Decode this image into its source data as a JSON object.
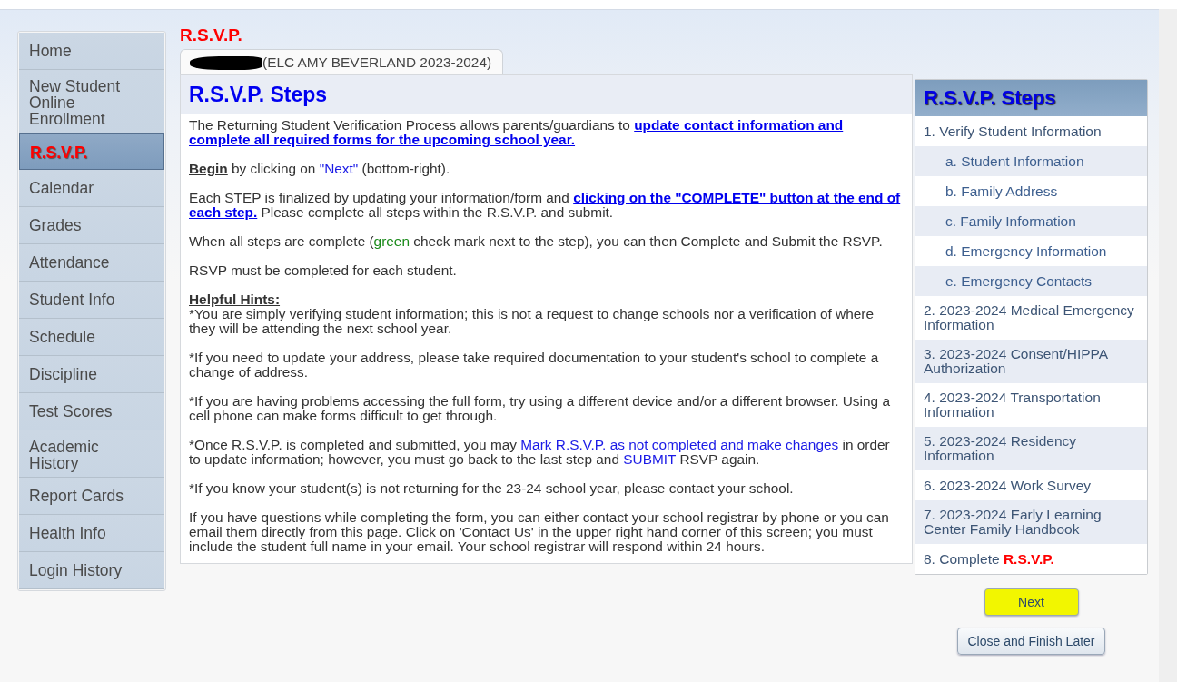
{
  "page_title": "R.S.V.P.",
  "sidebar": {
    "items": [
      {
        "label": "Home",
        "selected": false
      },
      {
        "label": "New Student Online Enrollment",
        "selected": false
      },
      {
        "label": "R.S.V.P.",
        "selected": true
      },
      {
        "label": "Calendar",
        "selected": false
      },
      {
        "label": "Grades",
        "selected": false
      },
      {
        "label": "Attendance",
        "selected": false
      },
      {
        "label": "Student Info",
        "selected": false
      },
      {
        "label": "Schedule",
        "selected": false
      },
      {
        "label": "Discipline",
        "selected": false
      },
      {
        "label": "Test Scores",
        "selected": false
      },
      {
        "label": "Academic History",
        "selected": false
      },
      {
        "label": "Report Cards",
        "selected": false
      },
      {
        "label": "Health Info",
        "selected": false
      },
      {
        "label": "Login History",
        "selected": false
      }
    ]
  },
  "student_tab": {
    "redacted": true,
    "label": "(ELC AMY BEVERLAND 2023-2024)",
    "selected": true
  },
  "content": {
    "title": "R.S.V.P. Steps",
    "blocks": [
      {
        "kind": "paragraph",
        "segments": [
          {
            "kind": "text",
            "t": "The Returning Student Verification Process allows parents/guardians to "
          },
          {
            "kind": "link",
            "t": "update contact information and"
          },
          {
            "kind": "link",
            "t": "complete all required forms for the upcoming school year."
          }
        ]
      },
      {
        "kind": "paragraph",
        "segments": [
          {
            "kind": "strong",
            "t": "Begin"
          },
          {
            "kind": "text",
            "t": " by clicking on "
          },
          {
            "kind": "accent",
            "t": "\"Next\""
          },
          {
            "kind": "text",
            "t": " (bottom-right)."
          }
        ]
      },
      {
        "kind": "paragraph",
        "segments": [
          {
            "kind": "text",
            "t": "Each STEP is finalized by updating your information/form and "
          },
          {
            "kind": "link",
            "t": "clicking on the \"COMPLETE\" button at the end of"
          },
          {
            "kind": "link",
            "t": "each step."
          },
          {
            "kind": "text",
            "t": " Please complete all steps within the R.S.V.P. and submit."
          }
        ]
      },
      {
        "kind": "paragraph",
        "segments": [
          {
            "kind": "text",
            "t": "When all steps are complete ("
          },
          {
            "kind": "green",
            "t": "green"
          },
          {
            "kind": "text",
            "t": " check mark next to the step), you can then Complete and Submit the RSVP."
          }
        ]
      },
      {
        "kind": "paragraph",
        "segments": [
          {
            "kind": "text",
            "t": "RSVP must be completed for each student."
          }
        ]
      },
      {
        "kind": "heading",
        "segments": [
          {
            "kind": "text",
            "t": "Helpful Hints:"
          }
        ]
      },
      {
        "kind": "hint",
        "segments": [
          {
            "kind": "text",
            "t": "*You are simply verifying student information; this is not a request to change schools nor a verification of where they will be attending the next school year."
          }
        ]
      },
      {
        "kind": "paragraph",
        "segments": [
          {
            "kind": "text",
            "t": "*If you need to update your address, please take required documentation to your student's school to complete a change of address."
          }
        ]
      },
      {
        "kind": "paragraph",
        "segments": [
          {
            "kind": "text",
            "t": "*If you are having problems accessing the full form, try using a different device and/or a different browser. Using a cell phone can make forms difficult to get through."
          }
        ]
      },
      {
        "kind": "paragraph",
        "segments": [
          {
            "kind": "text",
            "t": "*Once R.S.V.P. is completed and submitted, you may "
          },
          {
            "kind": "accent",
            "t": "Mark R.S.V.P. as not completed and make changes"
          },
          {
            "kind": "text",
            "t": " in order to update information; however, you must go back to the last step and "
          },
          {
            "kind": "accent",
            "t": "SUBMIT"
          },
          {
            "kind": "text",
            "t": " RSVP again."
          }
        ]
      },
      {
        "kind": "paragraph",
        "segments": [
          {
            "kind": "text",
            "t": "*If you know your student(s) is not returning for the 23-24 school year, please contact your school."
          }
        ]
      },
      {
        "kind": "paragraph",
        "segments": [
          {
            "kind": "text",
            "t": "If you have questions while completing the form, you can either contact your school registrar by phone or you can email them directly from this page. Click on 'Contact Us' in the upper right hand corner of this screen; you must include the student full name in your email. Your school registrar will respond within 24 hours."
          }
        ]
      }
    ]
  },
  "steps_panel": {
    "title": "R.S.V.P. Steps",
    "steps": [
      {
        "kind": "step",
        "segments": [
          {
            "kind": "text",
            "t": "1. Verify Student Information"
          }
        ]
      },
      {
        "kind": "substep",
        "segments": [
          {
            "kind": "text",
            "t": "a. Student Information"
          }
        ]
      },
      {
        "kind": "substep",
        "segments": [
          {
            "kind": "text",
            "t": "b. Family Address"
          }
        ]
      },
      {
        "kind": "substep",
        "segments": [
          {
            "kind": "text",
            "t": "c. Family Information"
          }
        ]
      },
      {
        "kind": "substep",
        "segments": [
          {
            "kind": "text",
            "t": "d. Emergency Information"
          }
        ]
      },
      {
        "kind": "substep",
        "segments": [
          {
            "kind": "text",
            "t": "e. Emergency Contacts"
          }
        ]
      },
      {
        "kind": "step",
        "segments": [
          {
            "kind": "text",
            "t": "2. 2023-2024 Medical Emergency Information"
          }
        ]
      },
      {
        "kind": "step",
        "segments": [
          {
            "kind": "text",
            "t": "3. 2023-2024 Consent/HIPPA Authorization"
          }
        ]
      },
      {
        "kind": "step",
        "segments": [
          {
            "kind": "text",
            "t": "4. 2023-2024 Transportation Information"
          }
        ]
      },
      {
        "kind": "step",
        "segments": [
          {
            "kind": "text",
            "t": "5. 2023-2024 Residency Information"
          }
        ]
      },
      {
        "kind": "step",
        "segments": [
          {
            "kind": "text",
            "t": "6. 2023-2024 Work Survey"
          }
        ]
      },
      {
        "kind": "step",
        "segments": [
          {
            "kind": "text",
            "t": "7. 2023-2024 Early Learning Center Family Handbook"
          }
        ]
      },
      {
        "kind": "step",
        "segments": [
          {
            "kind": "text",
            "t": "8. Complete "
          },
          {
            "kind": "red",
            "t": "R.S.V.P."
          }
        ]
      }
    ]
  },
  "buttons": [
    {
      "label": "Next",
      "highlighted": true
    },
    {
      "label": "Close and Finish Later",
      "highlighted": false
    }
  ]
}
